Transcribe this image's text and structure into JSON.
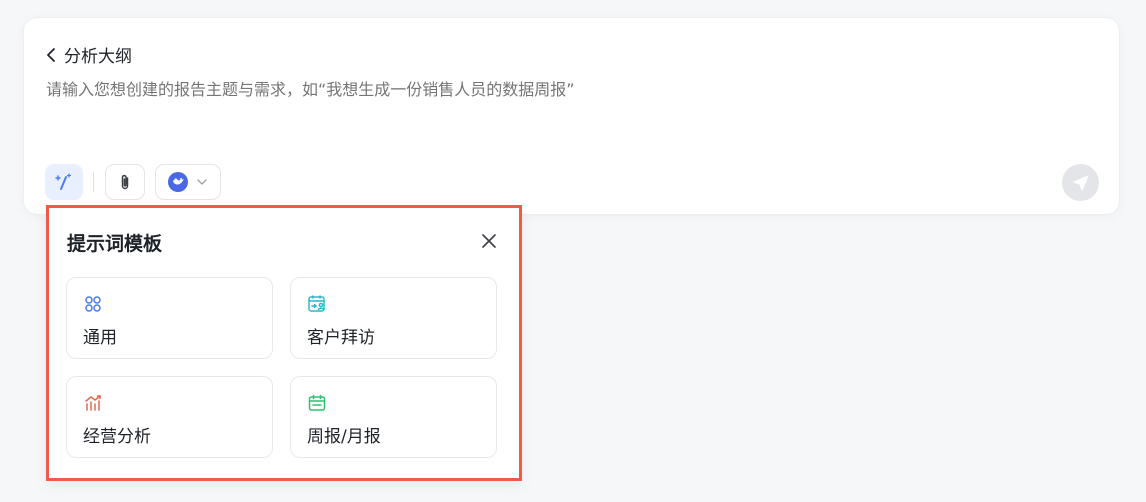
{
  "composer": {
    "back_label": "分析大纲",
    "prompt_placeholder": "请输入您想创建的报告主题与需求，如“我想生成一份销售人员的数据周报”",
    "tools": {
      "magic_icon": "magic-wand-icon",
      "attach_icon": "paperclip-icon",
      "model_icon": "model-avatar-icon",
      "model_dropdown_icon": "chevron-down-icon",
      "send_icon": "send-icon"
    }
  },
  "template_panel": {
    "title": "提示词模板",
    "close_icon": "close-icon",
    "cards": [
      {
        "label": "通用",
        "icon": "command-icon",
        "color": "#4a7cf7"
      },
      {
        "label": "客户拜访",
        "icon": "calendar-user-icon",
        "color": "#25b7c9"
      },
      {
        "label": "经营分析",
        "icon": "bar-chart-trend-icon",
        "color": "#e0694f"
      },
      {
        "label": "周报/月报",
        "icon": "calendar-icon",
        "color": "#2fbf71"
      }
    ]
  },
  "colors": {
    "accent": "#4a7cf7",
    "highlight_border": "#f05a4b"
  }
}
